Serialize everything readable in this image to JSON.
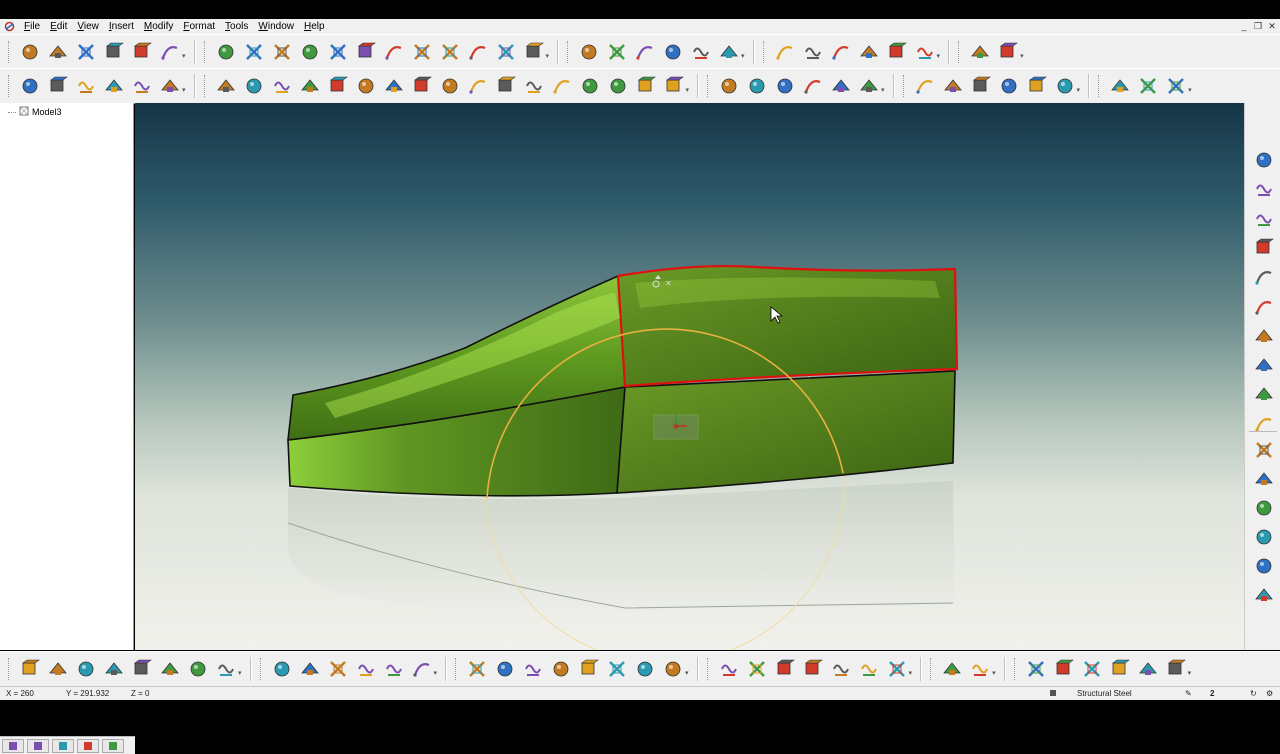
{
  "menubar": {
    "items": [
      "File",
      "Edit",
      "View",
      "Insert",
      "Modify",
      "Format",
      "Tools",
      "Window",
      "Help"
    ]
  },
  "window_controls": [
    "minimize-icon",
    "restore-icon",
    "close-icon"
  ],
  "toolbar_top": {
    "groups": [
      [
        "new-file-icon",
        "open-folder-icon",
        "save-icon",
        "undo-icon",
        "redo-icon",
        "cut-icon"
      ],
      [
        "box-solid-icon",
        "sphere-icon",
        "move-icon",
        "zoom-icon",
        "zoom-extents-icon",
        "zoom-window-icon",
        "grid-icon",
        "view-3d-icon",
        "view-rotate-icon",
        "render-icon",
        "shade-icon",
        "help-query-icon"
      ],
      [
        "delete-icon",
        "explode-icon",
        "surface-edit-icon",
        "copy-icon",
        "transform-icon",
        "align-icon"
      ],
      [
        "select-arrow-icon",
        "select-surface-icon",
        "select-edge-icon",
        "select-body-icon",
        "select-face-icon",
        "measure-icon"
      ],
      [
        "wrench-icon",
        "package-icon"
      ]
    ]
  },
  "toolbar_second": {
    "groups": [
      [
        "curve-icon",
        "line-icon",
        "circle-icon",
        "rectangle-icon",
        "arc-icon",
        "arc3-icon"
      ],
      [
        "spline-icon",
        "bezier-icon",
        "polygon-icon",
        "wave-curve-icon",
        "ellipse-icon",
        "blend-icon",
        "offset-curve-icon",
        "cylinder-icon",
        "loft-icon",
        "trim-curve-icon",
        "extend-curve-icon",
        "split-curve-icon",
        "fillet-curve-icon",
        "project-curve-icon",
        "intersect-curve-icon",
        "join-curve-icon",
        "reverse-curve-icon"
      ],
      [
        "texture-icon",
        "decal-icon",
        "material-icon",
        "light-icon",
        "camera-icon",
        "environment-icon"
      ],
      [
        "plane-icon",
        "axis-icon",
        "point-cloud-icon",
        "section-icon",
        "analysis-icon",
        "mesh-icon"
      ],
      [
        "view-iso-icon",
        "view-front-icon",
        "view-top-icon"
      ]
    ]
  },
  "toolbar_bottom": {
    "groups": [
      [
        "plane-surface-icon",
        "flat-surface-icon",
        "extrude-surface-icon",
        "revolve-surface-icon",
        "sweep-surface-icon",
        "loft-surface-icon",
        "blend-surface-icon",
        "patch-surface-icon"
      ],
      [
        "net-surface-icon",
        "skin-surface-icon",
        "offset-surface-icon",
        "fillet-surface-icon",
        "chamfer-surface-icon",
        "rail-surface-icon"
      ],
      [
        "solid-extrude-icon",
        "solid-revolve-icon",
        "solid-sweep-icon",
        "solid-box-icon",
        "solid-cylinder-icon",
        "solid-cone-icon",
        "solid-sphere-icon",
        "solid-torus-icon"
      ],
      [
        "boolean-union-icon",
        "boolean-subtract-icon",
        "lattice-icon",
        "solid-shell-icon",
        "solid-fillet-icon",
        "solid-chamfer-icon",
        "solid-draft-icon"
      ],
      [
        "stitch-icon",
        "heal-icon"
      ],
      [
        "mesh-sphere-icon",
        "mesh-smooth-icon",
        "mesh-refine-icon",
        "mesh-analyze-icon",
        "mesh-repair-icon",
        "mesh-export-icon"
      ]
    ]
  },
  "rightbar": {
    "top_icons": [
      "freeform-push-icon",
      "freeform-pull-icon",
      "freeform-twist-icon",
      "freeform-bend-icon",
      "freeform-stretch-icon",
      "freeform-wave-icon",
      "freeform-taper-icon",
      "freeform-sweep-icon",
      "freeform-smooth-icon",
      "freeform-pin-icon"
    ],
    "bottom_icons": [
      "cube-front-icon",
      "cube-side-icon",
      "cube-red-icon",
      "cube-top-icon",
      "cube-iso-icon",
      "cube-section-icon"
    ]
  },
  "tree": {
    "root": "Model3"
  },
  "tree_tabs": [
    "model-tree-tab-icon",
    "edit-tab-icon",
    "material-tab-icon",
    "render-tab-icon",
    "library-tab-icon"
  ],
  "status": {
    "x": "X = 260",
    "y": "Y = 291.932",
    "z": "Z = 0",
    "material": "Structural Steel"
  },
  "colors": {
    "surface_green": "#5d8f1f",
    "highlight_edge": "#e01010",
    "circle_orange": "#e8b040",
    "viewport_top": "#153547",
    "viewport_bottom": "#f1f1ec"
  }
}
